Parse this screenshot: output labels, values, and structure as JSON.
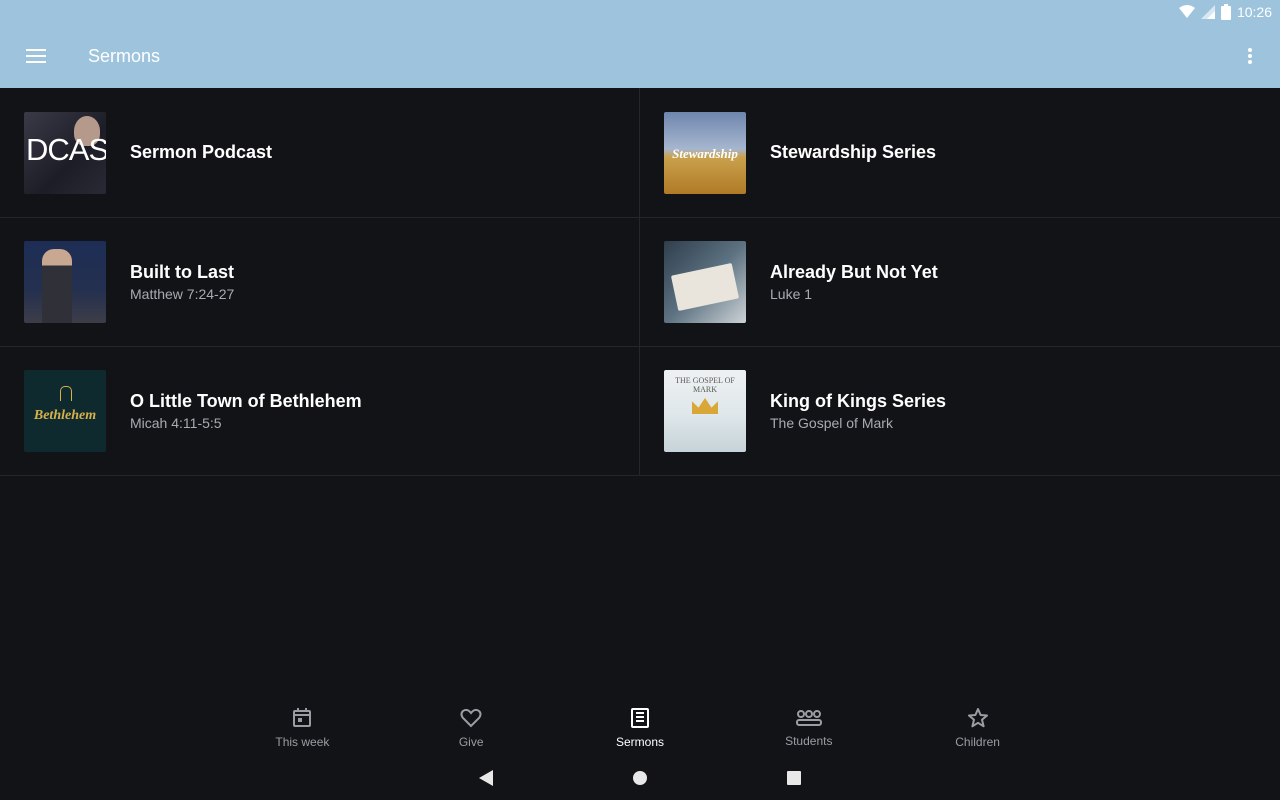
{
  "status_bar": {
    "time": "10:26",
    "icons": [
      "wifi-icon",
      "signal-icon",
      "battery-icon"
    ]
  },
  "app_bar": {
    "title": "Sermons",
    "menu_icon": "hamburger-menu-icon",
    "overflow_icon": "more-vert-icon",
    "background": "#9dc3dd"
  },
  "series": [
    {
      "title": "Sermon Podcast",
      "subtitle": "",
      "thumb_text": "DCAS"
    },
    {
      "title": "Stewardship Series",
      "subtitle": "",
      "thumb_text": "Stewardship"
    },
    {
      "title": "Built to Last",
      "subtitle": "Matthew 7:24-27",
      "thumb_text": ""
    },
    {
      "title": "Already But Not Yet",
      "subtitle": "Luke 1",
      "thumb_text": ""
    },
    {
      "title": "O Little Town of Bethlehem",
      "subtitle": "Micah 4:11-5:5",
      "thumb_text": "Bethlehem"
    },
    {
      "title": "King of Kings Series",
      "subtitle": "The Gospel of Mark",
      "thumb_text": "THE GOSPEL OF MARK"
    }
  ],
  "bottom_nav": [
    {
      "label": "This week",
      "icon": "calendar-icon",
      "active": false
    },
    {
      "label": "Give",
      "icon": "heart-icon",
      "active": false
    },
    {
      "label": "Sermons",
      "icon": "book-icon",
      "active": true
    },
    {
      "label": "Students",
      "icon": "group-icon",
      "active": false
    },
    {
      "label": "Children",
      "icon": "star-icon",
      "active": false
    }
  ],
  "colors": {
    "background": "#121316",
    "divider": "#24262b",
    "nav_inactive": "#9a9da4",
    "nav_active": "#ffffff",
    "subtitle": "#a8abb2"
  }
}
